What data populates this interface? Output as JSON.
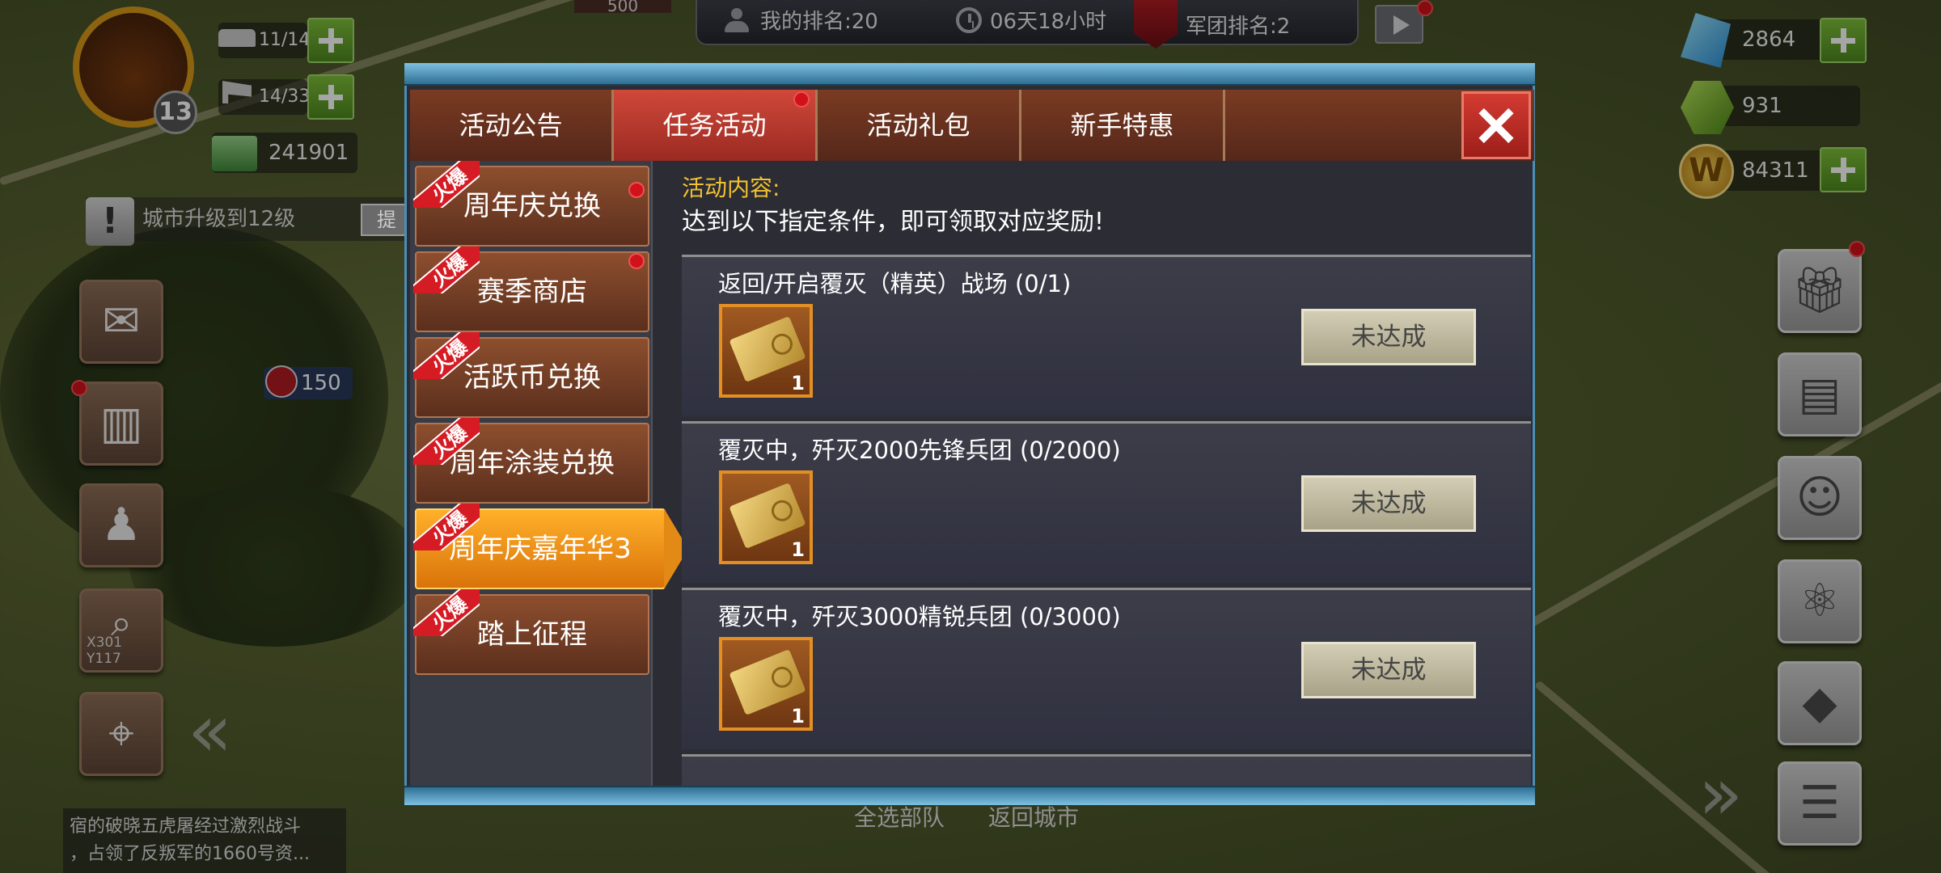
{
  "top_bar": {
    "marker_value": "500",
    "my_rank": "我的排名:20",
    "time_left": "06天18小时",
    "legion_rank": "军团排名:2"
  },
  "resources": {
    "crystal": "2864",
    "gem": "931",
    "gold": "84311"
  },
  "player": {
    "level": "13",
    "units": "11/14",
    "flags": "14/33",
    "cash": "241901"
  },
  "notice": {
    "text": "城市升级到12级",
    "button": "提交"
  },
  "map": {
    "army_value": "150",
    "coords": "X301 Y117"
  },
  "chat": {
    "line1": "宿的破晓五虎屠经过激烈战斗",
    "line2": "，占领了反叛军的1660号资..."
  },
  "bottom_nav": {
    "select_all": "全选部队",
    "return_city": "返回城市"
  },
  "modal": {
    "tabs": [
      {
        "label": "活动公告"
      },
      {
        "label": "任务活动"
      },
      {
        "label": "活动礼包"
      },
      {
        "label": "新手特惠"
      }
    ],
    "hot_tag": "火爆",
    "left_items": [
      {
        "label": "周年庆兑换"
      },
      {
        "label": "赛季商店"
      },
      {
        "label": "活跃币兑换"
      },
      {
        "label": "周年涂装兑换"
      },
      {
        "label": "周年庆嘉年华3"
      },
      {
        "label": "踏上征程"
      }
    ],
    "intro_title": "活动内容:",
    "intro_text": "达到以下指定条件，即可领取对应奖励!",
    "tasks": [
      {
        "title": "返回/开启覆灭（精英）战场 (0/1)",
        "reward_qty": "1",
        "status": "未达成"
      },
      {
        "title": "覆灭中，歼灭2000先锋兵团 (0/2000)",
        "reward_qty": "1",
        "status": "未达成"
      },
      {
        "title": "覆灭中，歼灭3000精锐兵团 (0/3000)",
        "reward_qty": "1",
        "status": "未达成"
      }
    ]
  },
  "colors": {
    "accent_red": "#d0483a",
    "highlight_orange": "#ffb02a",
    "intro_yellow": "#f2c230",
    "plus_green": "#7fbf3a"
  }
}
